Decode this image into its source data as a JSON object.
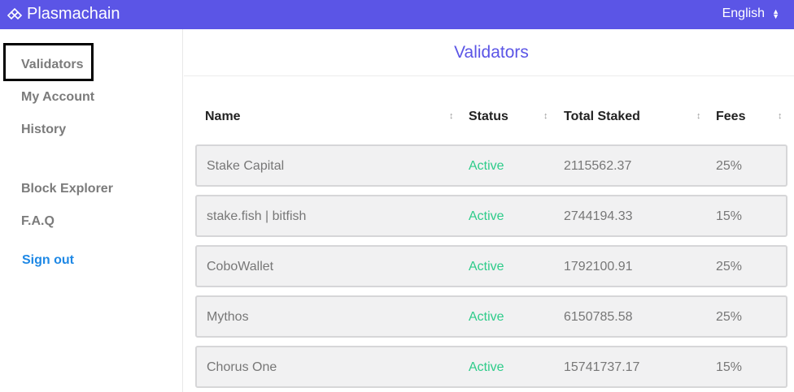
{
  "header": {
    "brand": "Plasmachain",
    "language": "English"
  },
  "sidebar": {
    "items": [
      {
        "label": "Validators"
      },
      {
        "label": "My Account"
      },
      {
        "label": "History"
      },
      {
        "label": "Block Explorer"
      },
      {
        "label": "F.A.Q"
      }
    ],
    "sign_out": "Sign out"
  },
  "main": {
    "title": "Validators",
    "columns": [
      "Name",
      "Status",
      "Total Staked",
      "Fees"
    ],
    "rows": [
      {
        "name": "Stake Capital",
        "status": "Active",
        "staked": "2115562.37",
        "fees": "25%"
      },
      {
        "name": "stake.fish | bitfish",
        "status": "Active",
        "staked": "2744194.33",
        "fees": "15%"
      },
      {
        "name": "CoboWallet",
        "status": "Active",
        "staked": "1792100.91",
        "fees": "25%"
      },
      {
        "name": "Mythos",
        "status": "Active",
        "staked": "6150785.58",
        "fees": "25%"
      },
      {
        "name": "Chorus One",
        "status": "Active",
        "staked": "15741737.17",
        "fees": "15%"
      }
    ]
  },
  "colors": {
    "brand": "#5b55e6",
    "active_status": "#2ecc8a",
    "link": "#1e88e5"
  }
}
